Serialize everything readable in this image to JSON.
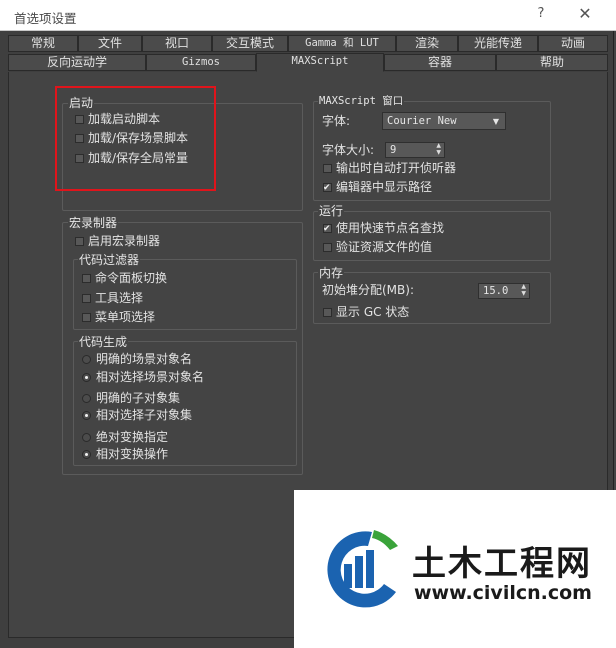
{
  "window": {
    "title": "首选项设置",
    "help": "?",
    "close": "✕"
  },
  "tabs_row1": [
    "常规",
    "文件",
    "视口",
    "交互模式",
    "Gamma 和 LUT",
    "渲染",
    "光能传递",
    "动画"
  ],
  "tabs_row2": [
    "反向运动学",
    "Gizmos",
    "MAXScript",
    "容器",
    "帮助"
  ],
  "active_tab": "MAXScript",
  "startup": {
    "title": "启动",
    "items": [
      {
        "label": "加载启动脚本",
        "checked": false
      },
      {
        "label": "加载/保存场景脚本",
        "checked": false
      },
      {
        "label": "加载/保存全局常量",
        "checked": false
      }
    ]
  },
  "macro": {
    "title": "宏录制器",
    "enable": {
      "label": "启用宏录制器",
      "checked": false
    },
    "filter": {
      "title": "代码过滤器",
      "items": [
        {
          "label": "命令面板切换",
          "checked": false
        },
        {
          "label": "工具选择",
          "checked": false
        },
        {
          "label": "菜单项选择",
          "checked": false
        }
      ]
    },
    "codegen": {
      "title": "代码生成",
      "groups": [
        [
          {
            "label": "明确的场景对象名",
            "checked": false
          },
          {
            "label": "相对选择场景对象名",
            "checked": true
          }
        ],
        [
          {
            "label": "明确的子对象集",
            "checked": false
          },
          {
            "label": "相对选择子对象集",
            "checked": true
          }
        ],
        [
          {
            "label": "绝对变换指定",
            "checked": false
          },
          {
            "label": "相对变换操作",
            "checked": true
          }
        ]
      ]
    }
  },
  "editor": {
    "title": "MAXScript 窗口",
    "font_label": "字体:",
    "font_value": "Courier New",
    "size_label": "字体大小:",
    "size_value": "9",
    "items": [
      {
        "label": "输出时自动打开侦听器",
        "checked": false
      },
      {
        "label": "编辑器中显示路径",
        "checked": true
      }
    ]
  },
  "run": {
    "title": "运行",
    "items": [
      {
        "label": "使用快速节点名查找",
        "checked": true
      },
      {
        "label": "验证资源文件的值",
        "checked": false
      }
    ]
  },
  "memory": {
    "title": "内存",
    "heap_label": "初始堆分配(MB):",
    "heap_value": "15.0",
    "gc": {
      "label": "显示 GC 状态",
      "checked": false
    }
  },
  "watermark": {
    "brand": "土木工程网",
    "url": "www.civilcn.com",
    "color_blue": "#1b63b0",
    "color_green": "#3aa33a"
  },
  "colors": {
    "highlight": "#e0141b"
  }
}
